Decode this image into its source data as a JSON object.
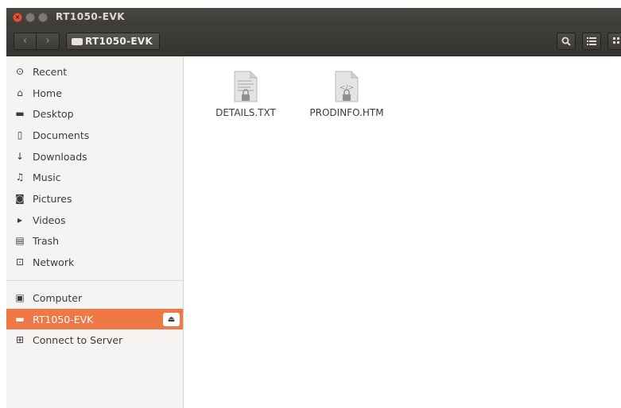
{
  "window": {
    "title": "RT1050-EVK"
  },
  "titlebar": {
    "close_glyph": "×"
  },
  "toolbar": {
    "back_glyph": "‹",
    "forward_glyph": "›",
    "path_label": "RT1050-EVK",
    "search_glyph": "🔍",
    "list_glyph": "☰",
    "grid_glyph": "⋮⋮"
  },
  "sidebar": {
    "items": [
      {
        "label": "Recent",
        "icon": "clock-icon",
        "glyph": "⊙"
      },
      {
        "label": "Home",
        "icon": "home-icon",
        "glyph": "⌂"
      },
      {
        "label": "Desktop",
        "icon": "folder-icon",
        "glyph": "▬"
      },
      {
        "label": "Documents",
        "icon": "document-icon",
        "glyph": "▯"
      },
      {
        "label": "Downloads",
        "icon": "download-icon",
        "glyph": "↓"
      },
      {
        "label": "Music",
        "icon": "music-icon",
        "glyph": "♫"
      },
      {
        "label": "Pictures",
        "icon": "camera-icon",
        "glyph": "◙"
      },
      {
        "label": "Videos",
        "icon": "video-icon",
        "glyph": "▸"
      },
      {
        "label": "Trash",
        "icon": "trash-icon",
        "glyph": "▤"
      },
      {
        "label": "Network",
        "icon": "network-icon",
        "glyph": "⊡"
      }
    ],
    "devices": [
      {
        "label": "Computer",
        "icon": "computer-icon",
        "glyph": "▣"
      },
      {
        "label": "RT1050-EVK",
        "icon": "drive-icon",
        "glyph": "▬",
        "active": true,
        "eject_glyph": "⏏"
      },
      {
        "label": "Connect to Server",
        "icon": "server-icon",
        "glyph": "⊞"
      }
    ]
  },
  "files": [
    {
      "name": "DETAILS.TXT",
      "icon": "text-file-icon"
    },
    {
      "name": "PRODINFO.HTM",
      "icon": "html-file-icon",
      "glyph": "</>"
    }
  ],
  "colors": {
    "accent": "#f07746",
    "headerbar": "#3c3b37",
    "close": "#e8533b"
  }
}
